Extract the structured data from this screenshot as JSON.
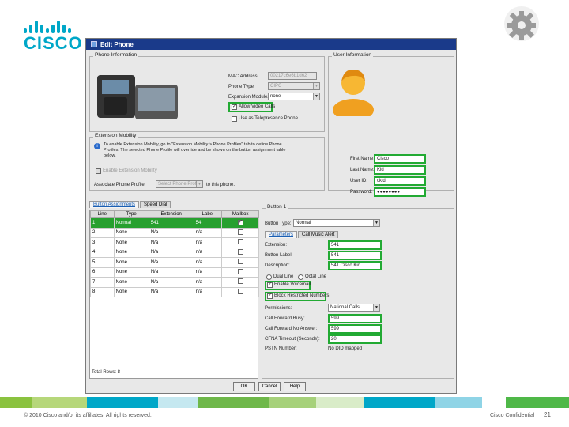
{
  "slide": {
    "logo_text": "CISCO",
    "footer_copyright": "© 2010 Cisco and/or its affiliates. All rights reserved.",
    "footer_confidential": "Cisco Confidential",
    "page_number": "21",
    "footer_colors": [
      "#8ac23f",
      "#b6d77a",
      "#00a7c8",
      "#c5e8f0",
      "#6fb84a",
      "#a6d17a",
      "#d9ecc8",
      "#00a7c8",
      "#8fd4e6",
      "#ffffff",
      "#4fb848"
    ]
  },
  "dialog": {
    "title": "Edit Phone",
    "phone_info": {
      "title": "Phone Information",
      "mac_label": "MAC Address",
      "mac_value": "00217c6e6b1d62",
      "phone_type_label": "Phone Type",
      "phone_type_value": "CIPC",
      "expansion_label": "Expansion Modules",
      "expansion_value": "none",
      "allow_video_label": "Allow Video Calls",
      "telepresence_label": "Use as Telepresence Phone"
    },
    "extension_mobility": {
      "title": "Extension Mobility",
      "info_text": "To enable Extension Mobility, go to \"Extension Mobility > Phone Profiles\" tab to define Phone Profiles. The selected Phone Profile will override and be shown on the button assignment table below.",
      "enable_label": "Enable Extension Mobility",
      "associate_label": "Associate Phone Profile",
      "associate_placeholder": "Select Phone Profile",
      "associate_suffix": "to this phone."
    },
    "user_info": {
      "title": "User Information",
      "first_name_label": "First Name:",
      "first_name_value": "Cisco",
      "last_name_label": "Last Name:",
      "last_name_value": "Kid",
      "user_id_label": "User ID:",
      "user_id_value": "ckid",
      "password_label": "Password:",
      "password_value": "●●●●●●●●"
    },
    "tabs": [
      "Button Assignments",
      "Speed Dial"
    ],
    "table": {
      "headers": [
        "Line",
        "Type",
        "Extension",
        "Label",
        "Mailbox"
      ],
      "rows": [
        {
          "line": "1",
          "type": "Normal",
          "ext": "541",
          "label": "54",
          "mailbox": "✓"
        },
        {
          "line": "2",
          "type": "None",
          "ext": "N/a",
          "label": "n/a",
          "mailbox": ""
        },
        {
          "line": "3",
          "type": "None",
          "ext": "N/a",
          "label": "n/a",
          "mailbox": ""
        },
        {
          "line": "4",
          "type": "None",
          "ext": "N/a",
          "label": "n/a",
          "mailbox": ""
        },
        {
          "line": "5",
          "type": "None",
          "ext": "N/a",
          "label": "n/a",
          "mailbox": ""
        },
        {
          "line": "6",
          "type": "None",
          "ext": "N/a",
          "label": "n/a",
          "mailbox": ""
        },
        {
          "line": "7",
          "type": "None",
          "ext": "N/a",
          "label": "n/a",
          "mailbox": ""
        },
        {
          "line": "8",
          "type": "None",
          "ext": "N/a",
          "label": "n/a",
          "mailbox": ""
        }
      ],
      "total_rows": "Total Rows: 8"
    },
    "button_panel": {
      "title": "Button 1",
      "button_type_label": "Button Type:",
      "button_type_value": "Normal",
      "subtabs": [
        "Parameters",
        "Call Music Alert"
      ],
      "extension_label": "Extension:",
      "extension_value": "541",
      "button_label_label": "Button Label:",
      "button_label_value": "541",
      "description_label": "Description:",
      "description_value": "541 Cisco Kid",
      "radio_dual": "Dual Line",
      "radio_octal": "Octal Line",
      "voicemail_label": "Enable Voicemail",
      "block_label": "Block Restricted Numbers",
      "permissions_label": "Permissions:",
      "permissions_value": "National Calls",
      "fwd_busy_label": "Call Forward Busy:",
      "fwd_busy_value": "599",
      "fwd_noanswer_label": "Call Forward No Answer:",
      "fwd_noanswer_value": "599",
      "cfna_label": "CFNA Timeout (Seconds):",
      "cfna_value": "20",
      "pstn_label": "PSTN Number:",
      "pstn_value": "No DID mapped"
    },
    "ok_label": "OK",
    "cancel_label": "Cancel",
    "help_label": "Help"
  }
}
